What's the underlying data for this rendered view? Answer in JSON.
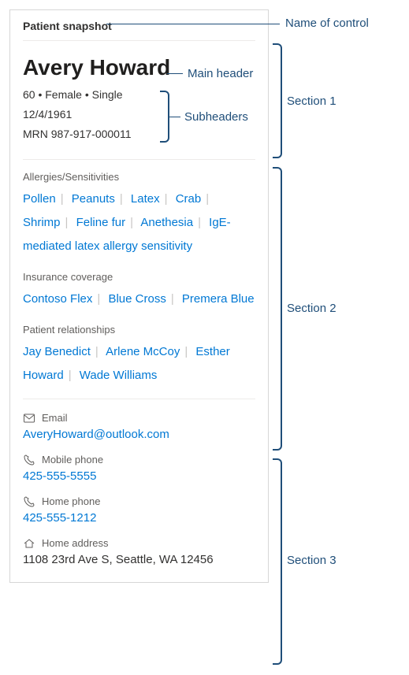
{
  "card_title": "Patient snapshot",
  "patient": {
    "name": "Avery Howard",
    "demographics": "60 • Female • Single",
    "dob": "12/4/1961",
    "mrn": "MRN 987-917-000011"
  },
  "allergies": {
    "label": "Allergies/Sensitivities",
    "items": [
      "Pollen",
      "Peanuts",
      "Latex",
      "Crab",
      "Shrimp",
      "Feline fur",
      "Anethesia",
      "IgE-mediated latex allergy sensitivity"
    ]
  },
  "insurance": {
    "label": "Insurance coverage",
    "items": [
      "Contoso Flex",
      "Blue Cross",
      "Premera Blue"
    ]
  },
  "relationships": {
    "label": "Patient relationships",
    "items": [
      "Jay Benedict",
      "Arlene McCoy",
      "Esther Howard",
      "Wade Williams"
    ]
  },
  "contacts": {
    "email": {
      "label": "Email",
      "value": "AveryHoward@outlook.com"
    },
    "mobile": {
      "label": "Mobile phone",
      "value": "425-555-5555"
    },
    "home_phone": {
      "label": "Home phone",
      "value": "425-555-1212"
    },
    "address": {
      "label": "Home address",
      "value": "1108 23rd Ave S, Seattle, WA 12456"
    }
  },
  "annotations": {
    "name_of_control": "Name of control",
    "main_header": "Main header",
    "subheaders": "Subheaders",
    "section1": "Section 1",
    "section2": "Section 2",
    "section3": "Section 3"
  }
}
